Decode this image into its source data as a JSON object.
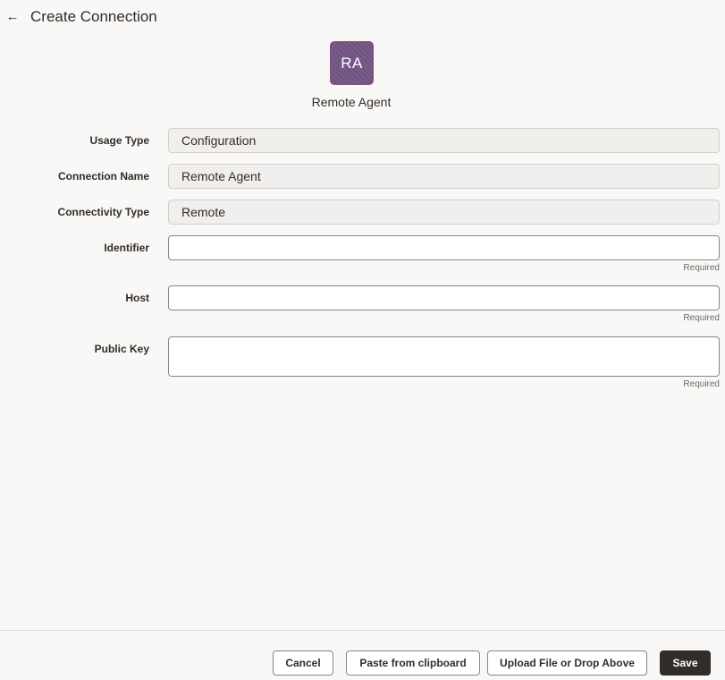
{
  "header": {
    "back_icon": "←",
    "title": "Create Connection"
  },
  "connection_type": {
    "avatar_initials": "RA",
    "name": "Remote Agent",
    "avatar_color": "#765a86"
  },
  "form": {
    "usage_type": {
      "label": "Usage Type",
      "value": "Configuration"
    },
    "connection_name": {
      "label": "Connection Name",
      "value": "Remote Agent"
    },
    "connectivity_type": {
      "label": "Connectivity Type",
      "value": "Remote"
    },
    "identifier": {
      "label": "Identifier",
      "value": "",
      "note": "Required"
    },
    "host": {
      "label": "Host",
      "value": "",
      "note": "Required"
    },
    "public_key": {
      "label": "Public Key",
      "value": "",
      "note": "Required"
    }
  },
  "footer": {
    "cancel_label": "Cancel",
    "paste_label": "Paste from clipboard",
    "upload_label": "Upload File or Drop Above",
    "save_label": "Save"
  }
}
